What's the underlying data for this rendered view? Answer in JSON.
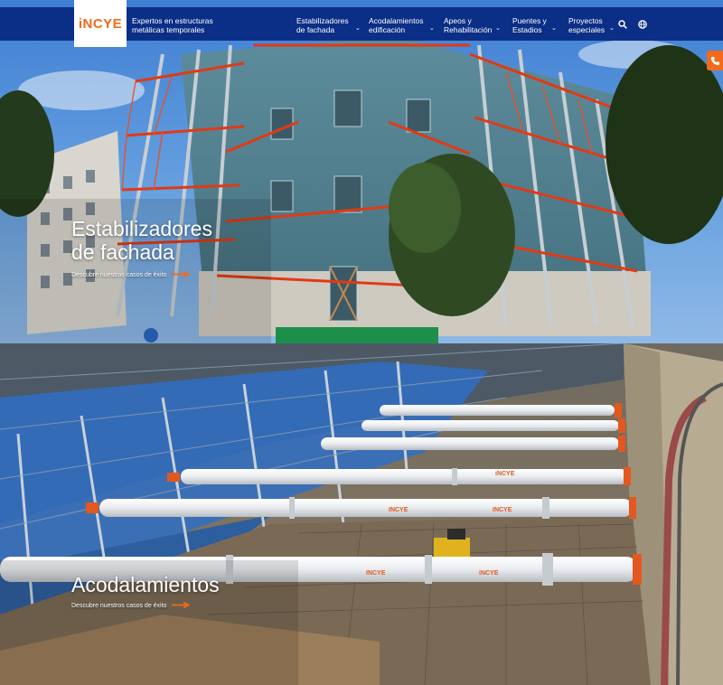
{
  "brand": {
    "logo_text": "iNCYE",
    "tagline": "Expertos en estructuras metálicas temporales",
    "accent": "#f26a1b",
    "primary": "#0b2f86"
  },
  "nav": {
    "items": [
      {
        "label": "Estabilizadores de fachada"
      },
      {
        "label": "Acodalamientos edificación"
      },
      {
        "label": "Apeos y Rehabilitación"
      },
      {
        "label": "Puentes y Estadios"
      },
      {
        "label": "Proyectos especiales"
      }
    ],
    "search_icon": "search-icon",
    "language_icon": "globe-icon",
    "phone_icon": "phone-icon"
  },
  "panels": [
    {
      "title": "Estabilizadores de fachada",
      "link": "Descubre nuestros casos de éxito",
      "arrow_icon": "arrow-right-icon"
    },
    {
      "title": "Acodalamientos",
      "link": "Descubre nuestros casos de éxito",
      "arrow_icon": "arrow-right-icon"
    }
  ],
  "strut_labels": [
    "iNCYE",
    "INCYE",
    "INCYE",
    "iNCYE",
    "INCYE"
  ]
}
